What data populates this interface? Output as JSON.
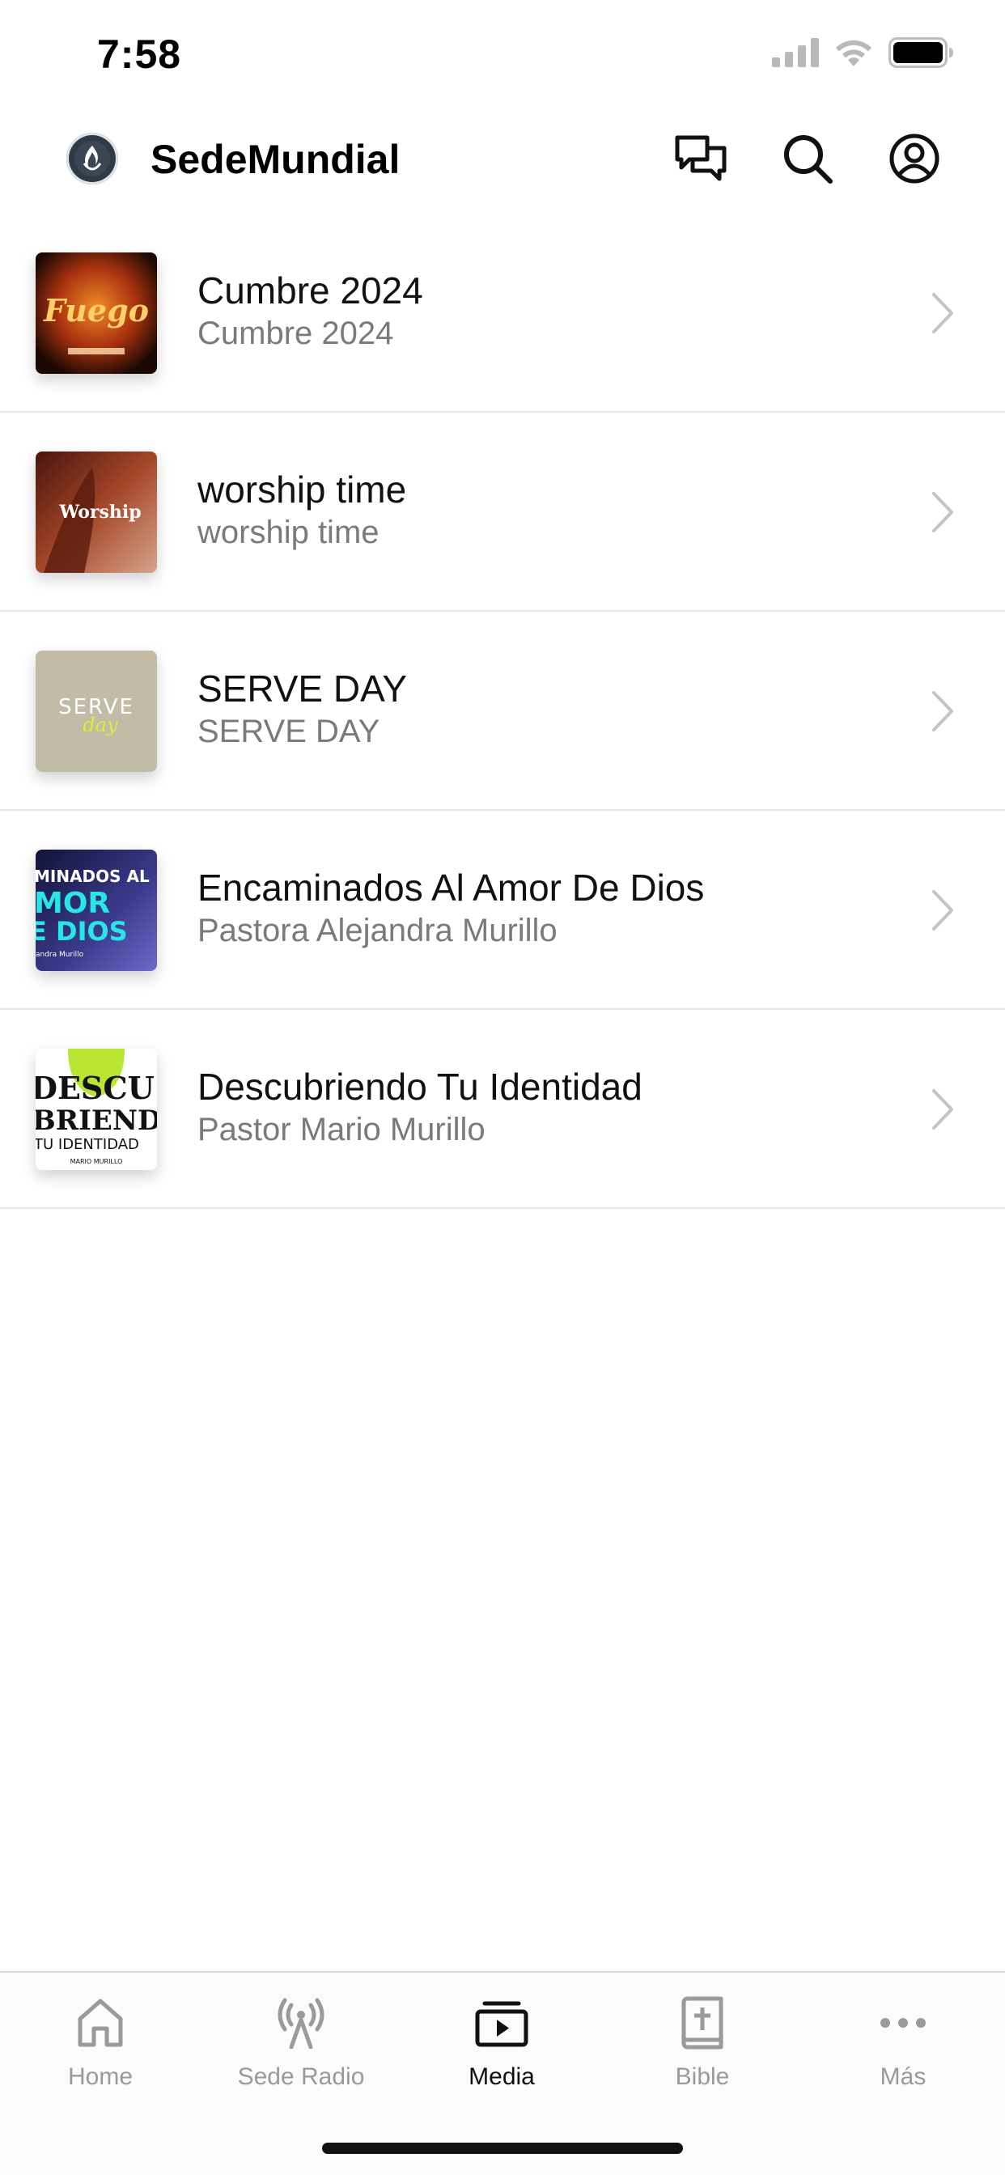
{
  "status_bar": {
    "time": "7:58",
    "icons": [
      "cellular-signal-icon",
      "wifi-icon",
      "battery-icon"
    ]
  },
  "header": {
    "app_title": "SedeMundial",
    "actions": [
      "chat-icon",
      "search-icon",
      "profile-icon"
    ]
  },
  "media_items": [
    {
      "title": "Cumbre 2024",
      "subtitle": "Cumbre 2024",
      "thumb_text": "Fuego",
      "thumb_colors": [
        "#2a0f06",
        "#d4561a"
      ]
    },
    {
      "title": "worship time",
      "subtitle": "worship time",
      "thumb_text": "Worship",
      "thumb_colors": [
        "#6b2516",
        "#b9552f"
      ]
    },
    {
      "title": "SERVE DAY",
      "subtitle": "SERVE DAY",
      "thumb_text": "SERVE",
      "thumb_text_2": "day",
      "thumb_colors": [
        "#bcb6a0",
        "#c9c4b0"
      ]
    },
    {
      "title": "Encaminados Al Amor De Dios",
      "subtitle": "Pastora Alejandra Murillo",
      "thumb_text": "MINADOS AL",
      "thumb_text_2": "MOR",
      "thumb_text_3": "E DIOS",
      "thumb_text_4": "andra Murillo",
      "thumb_colors": [
        "#1a1a4e",
        "#4a48a8"
      ]
    },
    {
      "title": "Descubriendo Tu Identidad",
      "subtitle": "Pastor Mario Murillo",
      "thumb_text": "DESCU",
      "thumb_text_2": "BRIENDO",
      "thumb_text_3": "TU IDENTIDAD",
      "thumb_text_4": "MARIO MURILLO",
      "thumb_colors": [
        "#ffffff",
        "#b8e632"
      ]
    }
  ],
  "tab_bar": {
    "tabs": [
      {
        "label": "Home",
        "icon": "home-icon",
        "active": false
      },
      {
        "label": "Sede Radio",
        "icon": "radio-tower-icon",
        "active": false
      },
      {
        "label": "Media",
        "icon": "media-play-icon",
        "active": true
      },
      {
        "label": "Bible",
        "icon": "bible-icon",
        "active": false
      },
      {
        "label": "Más",
        "icon": "more-dots-icon",
        "active": false
      }
    ]
  },
  "colors": {
    "active_tab": "#111111",
    "inactive_tab": "#9a9a9a",
    "subtitle": "#7a7a7a",
    "divider": "#e6e6e6"
  }
}
